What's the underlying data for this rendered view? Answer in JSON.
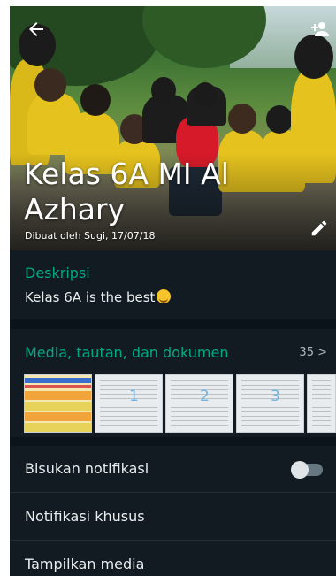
{
  "header": {
    "group_name": "Kelas 6A MI Al Azhary",
    "created_by": "Dibuat oleh Sugi, 17/07/18",
    "icons": {
      "back": "back-arrow-icon",
      "add_member": "add-person-icon",
      "edit": "pencil-icon"
    }
  },
  "description": {
    "label": "Deskripsi",
    "text": "Kelas 6A is the best",
    "emoji": "smiling-face-icon"
  },
  "media": {
    "label": "Media, tautan, dan dokumen",
    "count": "35 >",
    "thumbnails": [
      {
        "kind": "table-document",
        "number": ""
      },
      {
        "kind": "document",
        "number": "1"
      },
      {
        "kind": "document",
        "number": "2"
      },
      {
        "kind": "document",
        "number": "3"
      },
      {
        "kind": "document",
        "number": ""
      }
    ]
  },
  "settings": {
    "mute_label": "Bisukan notifikasi",
    "mute_enabled": false,
    "custom_notif_label": "Notifikasi khusus",
    "show_media_label": "Tampilkan media"
  },
  "colors": {
    "accent": "#00a884",
    "background": "#0b141a",
    "panel": "#111b21",
    "text": "#e9edef"
  }
}
